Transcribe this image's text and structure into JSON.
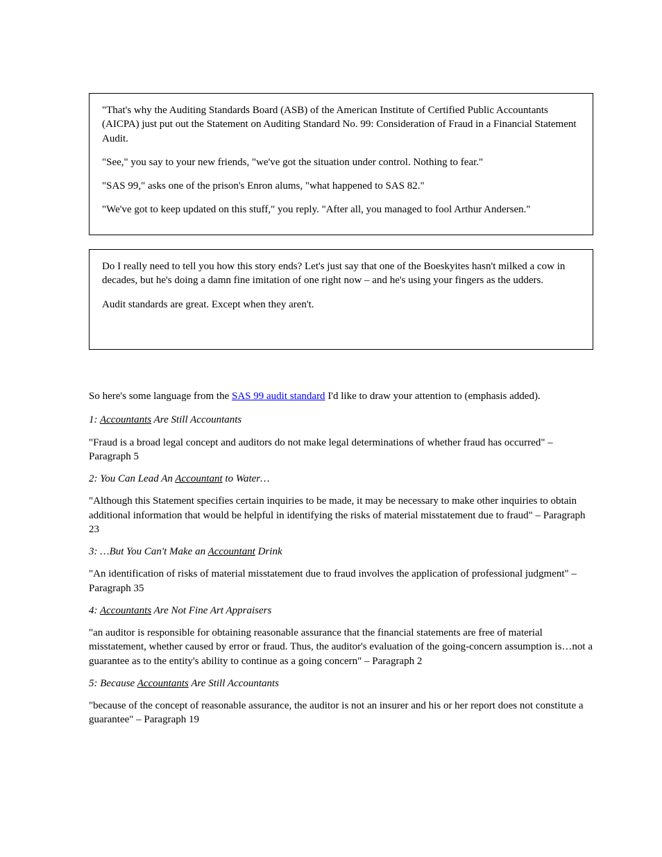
{
  "box1": {
    "p1": "\"That's why the Auditing Standards Board (ASB) of the American Institute of Certified Public Accountants (AICPA) just put out the Statement on Auditing Standard No. 99: Consideration of Fraud in a Financial Statement Audit.",
    "p2": "\"See,\" you say to your new friends, \"we've got the situation under control. Nothing to fear.\"",
    "p3": "\"SAS 99,\" asks one of the prison's Enron alums, \"what happened to SAS 82.\"",
    "p4": "\"We've got to keep updated on this stuff,\" you reply. \"After all, you managed to fool Arthur Andersen.\""
  },
  "box2": {
    "p1": "Do I really need to tell you how this story ends? Let's just say that one of the Boeskyites hasn't milked a cow in decades, but he's doing a damn fine imitation of one right now – and he's using your fingers as the udders.",
    "p2": "Audit standards are great. Except when they aren't."
  },
  "below": {
    "lead_in": "So here's some language from the ",
    "link_text": "SAS 99 audit standard",
    "lead_out": " I'd like to draw your attention to (emphasis added).",
    "terms": [
      {
        "num_italic": "1: ",
        "label_text": "Accountants",
        "after_label": " Are Still Accountants",
        "body": "\"Fraud is a broad legal concept and auditors do not make legal determinations of whether fraud has occurred\" – Paragraph 5"
      },
      {
        "num_italic": "2: You Can Lead An ",
        "label_text": "Accountant",
        "after_label": " to Water…",
        "body": "\"Although this Statement specifies certain inquiries to be made, it may be necessary to make other inquiries to obtain additional information that would be helpful in identifying the risks of material misstatement due to fraud\" – Paragraph 23"
      },
      {
        "num_italic": "3: …But You Can't Make an ",
        "label_text": "Accountant",
        "after_label": " Drink",
        "body": "\"An identification of risks of material misstatement due to fraud involves the application of professional judgment\" – Paragraph 35"
      },
      {
        "num_italic": "4: ",
        "label_text": "Accountants",
        "after_label": " Are Not Fine Art Appraisers",
        "body": "\"an auditor is responsible for obtaining reasonable assurance that the financial statements are free of material misstatement, whether caused by error or fraud. Thus, the auditor's evaluation of the going-concern assumption is…not a guarantee as to the entity's ability to continue as a going concern\" – Paragraph 2"
      },
      {
        "num_italic": "5: Because ",
        "label_text": "Accountants",
        "after_label": " Are Still Accountants",
        "body": "\"because of the concept of reasonable assurance, the auditor is not an insurer and his or her report does not constitute a guarantee\" – Paragraph 19"
      }
    ]
  }
}
